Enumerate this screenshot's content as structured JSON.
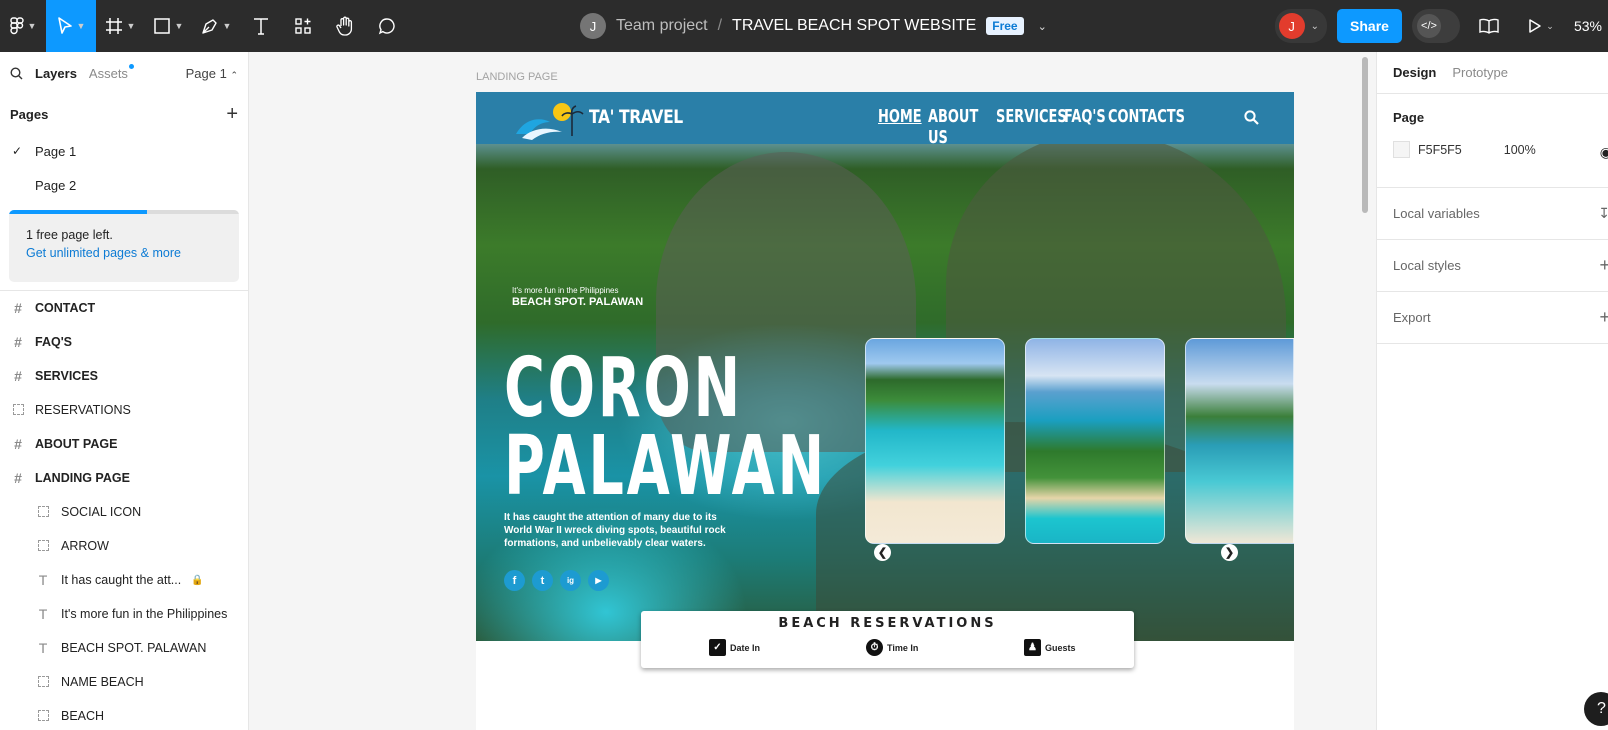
{
  "toolbar": {
    "team": "Team project",
    "separator": "/",
    "file_name": "TRAVEL BEACH SPOT WEBSITE",
    "plan_badge": "Free",
    "team_avatar": "J",
    "user_avatar": "J",
    "share_label": "Share",
    "zoom": "53%",
    "icons": [
      "figma-menu-icon",
      "move-tool-icon",
      "frame-tool-icon",
      "shape-tool-icon",
      "pen-tool-icon",
      "text-tool-icon",
      "resources-icon",
      "hand-tool-icon",
      "comment-icon",
      "dev-mode-icon",
      "library-icon",
      "present-icon"
    ],
    "colors": {
      "bar": "#2c2c2c",
      "accent": "#0d99ff",
      "user": "#e23c2d"
    }
  },
  "left_panel": {
    "tab_layers": "Layers",
    "tab_assets": "Assets",
    "page_selector": "Page 1",
    "pages_heading": "Pages",
    "pages": [
      "Page 1",
      "Page 2"
    ],
    "quota_text": "1 free page left.",
    "quota_link": "Get unlimited pages & more",
    "quota_progress": 0.6,
    "layers": [
      {
        "name": "CONTACT",
        "type": "frame"
      },
      {
        "name": "FAQ'S",
        "type": "frame"
      },
      {
        "name": "SERVICES",
        "type": "frame"
      },
      {
        "name": "RESERVATIONS",
        "type": "group"
      },
      {
        "name": "ABOUT PAGE",
        "type": "frame"
      },
      {
        "name": "LANDING PAGE",
        "type": "frame"
      }
    ],
    "children": [
      {
        "name": "SOCIAL ICON",
        "type": "group"
      },
      {
        "name": "ARROW",
        "type": "group"
      },
      {
        "name": "It has caught the att...",
        "type": "text",
        "locked": true
      },
      {
        "name": "It's more fun in the Philippines",
        "type": "text"
      },
      {
        "name": "BEACH SPOT. PALAWAN",
        "type": "text"
      },
      {
        "name": "NAME BEACH",
        "type": "group"
      },
      {
        "name": "BEACH",
        "type": "group"
      }
    ]
  },
  "canvas": {
    "frame_label": "LANDING PAGE",
    "site": {
      "brand": "TA' TRAVEL",
      "nav": [
        "HOME",
        "ABOUT US",
        "SERVICES",
        "FAQ'S",
        "CONTACTS"
      ],
      "tagline": "It's more fun in the Philippines",
      "spot": "BEACH SPOT. PALAWAN",
      "headline_1": "CORON",
      "headline_2": "PALAWAN",
      "description": "It has caught the attention of many due to its World War II wreck diving spots, beautiful rock formations, and unbelievably clear waters.",
      "socials": [
        "f",
        "t",
        "ig",
        "▶"
      ],
      "social_icons": [
        "facebook-icon",
        "twitter-icon",
        "instagram-icon",
        "youtube-icon"
      ],
      "arrow_left": "❮",
      "arrow_right": "❯",
      "reservations_title": "BEACH RESERVATIONS",
      "res_date": "Date In",
      "res_time": "Time In",
      "res_guests": "Guests",
      "colors": {
        "nav": "#2a7fa8",
        "social": "#1d9bd1"
      }
    }
  },
  "right_panel": {
    "tab_design": "Design",
    "tab_prototype": "Prototype",
    "page_heading": "Page",
    "page_fill": "F5F5F5",
    "page_opacity": "100%",
    "local_variables": "Local variables",
    "local_styles": "Local styles",
    "export": "Export",
    "help": "?"
  }
}
